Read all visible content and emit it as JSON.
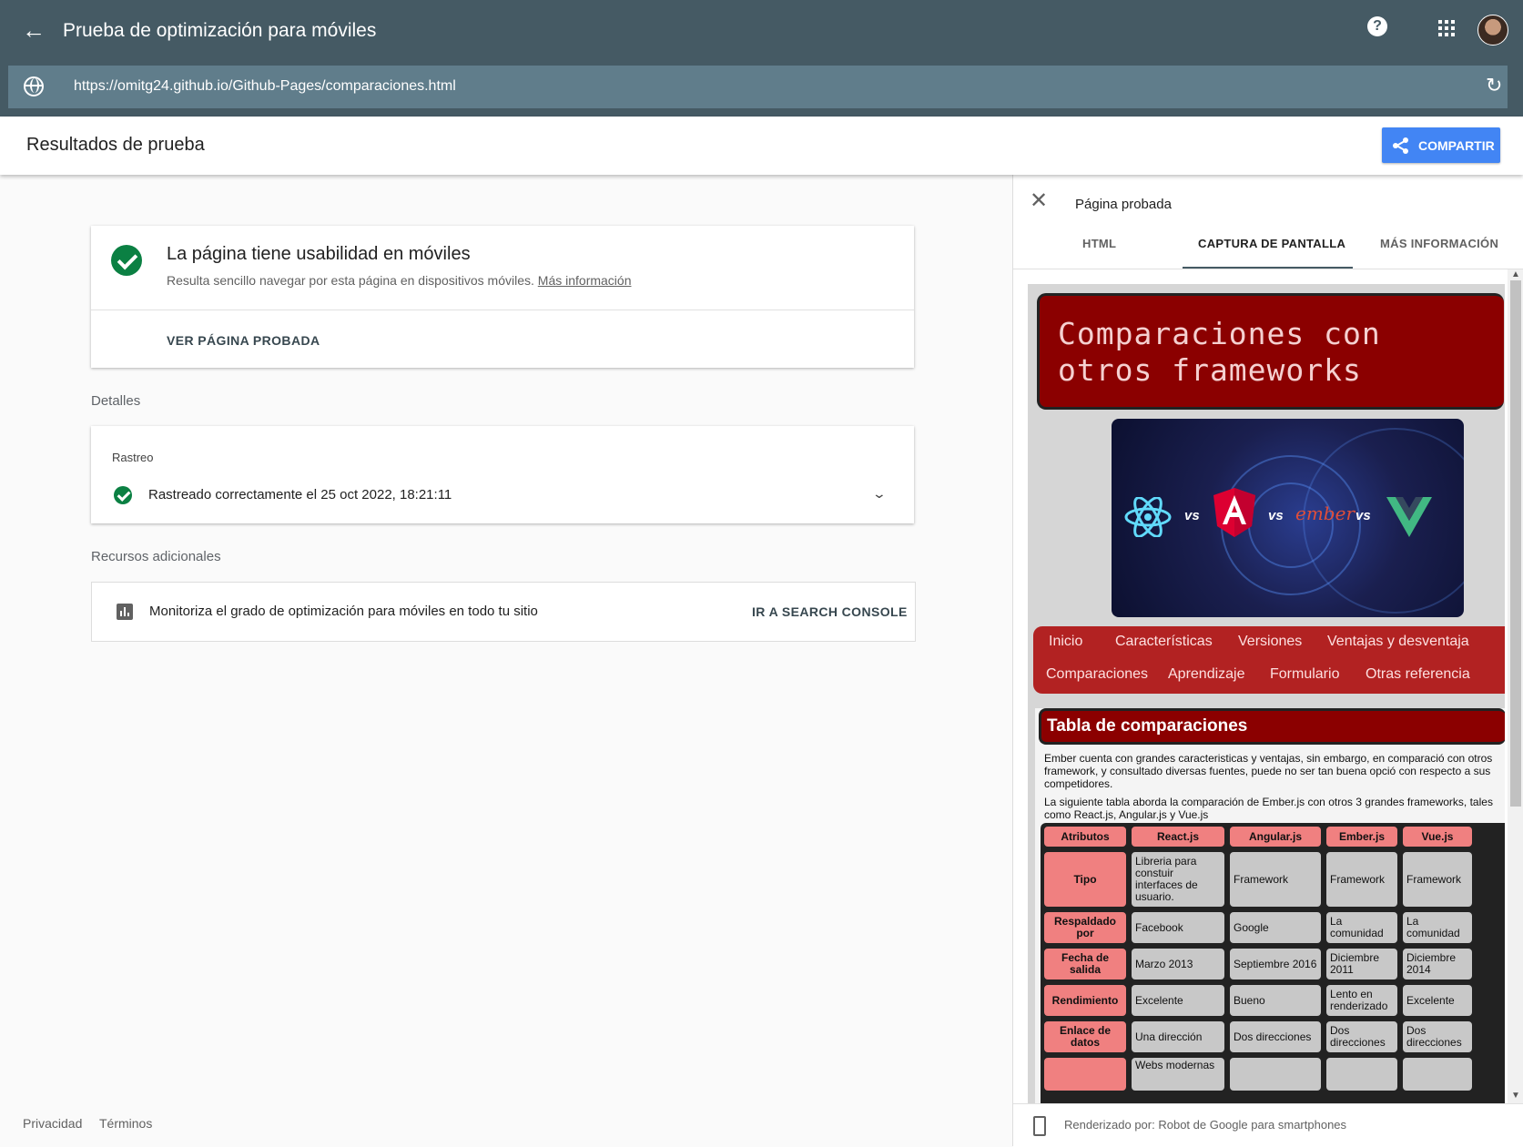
{
  "appbar": {
    "title": "Prueba de optimización para móviles",
    "url": "https://omitg24.github.io/Github-Pages/comparaciones.html"
  },
  "results_header": {
    "title": "Resultados de prueba",
    "share_label": "COMPARTIR"
  },
  "summary_card": {
    "heading": "La página tiene usabilidad en móviles",
    "description": "Resulta sencillo navegar por esta página en dispositivos móviles.",
    "more_link": "Más información",
    "view_button": "VER PÁGINA PROBADA"
  },
  "details": {
    "section_label": "Detalles",
    "crawl_label": "Rastreo",
    "crawl_status": "Rastreado correctamente el 25 oct 2022, 18:21:11"
  },
  "resources": {
    "section_label": "Recursos adicionales",
    "text": "Monitoriza el grado de optimización para móviles en todo tu sitio",
    "link": "IR A SEARCH CONSOLE"
  },
  "footer": {
    "privacy": "Privacidad",
    "terms": "Términos"
  },
  "side_panel": {
    "title": "Página probada",
    "tabs": [
      "HTML",
      "CAPTURA DE PANTALLA",
      "MÁS INFORMACIÓN"
    ],
    "active_tab": "CAPTURA DE PANTALLA",
    "rendered_by": "Renderizado por: Robot de Google para smartphones"
  },
  "screenshot": {
    "site_title_line1": "Comparaciones con",
    "site_title_line2": "otros frameworks",
    "hero_vs": [
      "vs",
      "vs",
      "vs"
    ],
    "hero_ember": "ember",
    "nav_row1": [
      "Inicio",
      "Características",
      "Versiones",
      "Ventajas y desventaja"
    ],
    "nav_row2": [
      "Comparaciones",
      "Aprendizaje",
      "Formulario",
      "Otras referencia"
    ],
    "section_title": "Tabla de comparaciones",
    "para1": "Ember cuenta con grandes caracteristicas y ventajas, sin embargo, en comparació con otros framework, y consultado diversas fuentes, puede no ser tan buena opció con respecto a sus competidores.",
    "para2": "La siguiente tabla aborda la comparación de Ember.js con otros 3 grandes frameworks, tales como React.js, Angular.js y Vue.js",
    "table_headers": [
      "Atributos",
      "React.js",
      "Angular.js",
      "Ember.js",
      "Vue.js"
    ],
    "table_rows": [
      [
        "Tipo",
        "Libreria para constuir interfaces de usuario.",
        "Framework",
        "Framework",
        "Framework"
      ],
      [
        "Respaldado por",
        "Facebook",
        "Google",
        "La comunidad",
        "La comunidad"
      ],
      [
        "Fecha de salida",
        "Marzo 2013",
        "Septiembre 2016",
        "Diciembre 2011",
        "Diciembre 2014"
      ],
      [
        "Rendimiento",
        "Excelente",
        "Bueno",
        "Lento en renderizado",
        "Excelente"
      ],
      [
        "Enlace de datos",
        "Una dirección",
        "Dos direcciones",
        "Dos direcciones",
        "Dos direcciones"
      ],
      [
        "",
        "Webs modernas",
        "",
        "",
        ""
      ]
    ]
  },
  "colors": {
    "topbar": "#455a64",
    "urlbar": "#607d8b",
    "accent": "#4285f4",
    "success": "#0b8043"
  },
  "icons": [
    "back-arrow-icon",
    "help-icon",
    "apps-grid-icon",
    "globe-icon",
    "reload-icon",
    "share-icon",
    "check-circle-icon",
    "chevron-down-icon",
    "bar-chart-icon",
    "close-icon",
    "smartphone-icon"
  ]
}
